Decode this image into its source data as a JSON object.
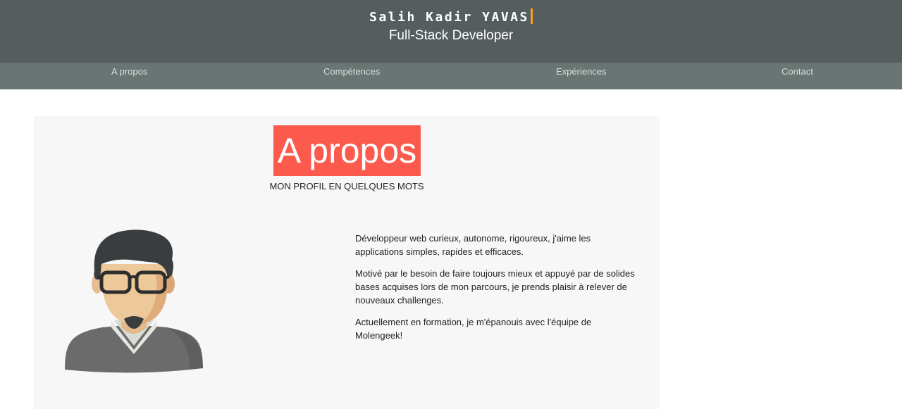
{
  "header": {
    "name": "Salih Kadir YAVAS",
    "role": "Full-Stack Developer"
  },
  "nav": {
    "items": [
      {
        "label": "A propos"
      },
      {
        "label": "Compétences"
      },
      {
        "label": "Expériences"
      },
      {
        "label": "Contact"
      }
    ]
  },
  "about": {
    "title": "A propos",
    "subtitle": "MON PROFIL EN QUELQUES MOTS",
    "avatar_icon": "developer-avatar-icon",
    "paragraphs": [
      "Développeur web curieux, autonome, rigoureux, j'aime les applications simples, rapides et efficaces.",
      "Motivé par le besoin de faire toujours mieux et appuyé par de solides bases acquises lors de mon parcours, je prends plaisir à relever de nouveaux challenges.",
      "Actuellement en formation, je m'épanouis avec l'équipe de Molengeek!"
    ]
  },
  "colors": {
    "header_bg": "#555d5f",
    "nav_bg": "#687572",
    "accent": "#fc5a4d",
    "cursor": "#f2a31b",
    "section_bg": "#f7f7f7"
  }
}
